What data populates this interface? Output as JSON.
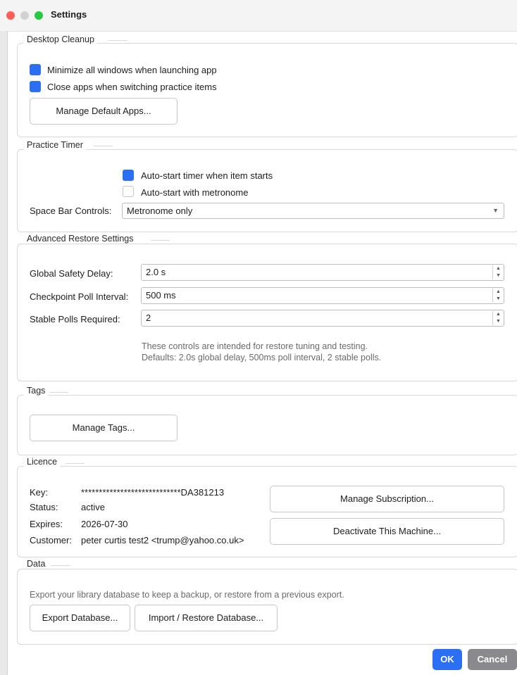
{
  "window": {
    "title": "Settings"
  },
  "desktop_cleanup": {
    "legend": "Desktop Cleanup",
    "minimize_label": "Minimize all windows when launching app",
    "minimize_checked": true,
    "close_apps_label": "Close apps when switching practice items",
    "close_apps_checked": true,
    "manage_apps_button": "Manage Default Apps..."
  },
  "practice_timer": {
    "legend": "Practice Timer",
    "autostart_label": "Auto-start timer when item starts",
    "autostart_checked": true,
    "metronome_label": "Auto-start with metronome",
    "metronome_checked": false,
    "space_bar_label": "Space Bar Controls:",
    "space_bar_value": "Metronome only"
  },
  "advanced_restore": {
    "legend": "Advanced Restore Settings",
    "global_delay_label": "Global Safety Delay:",
    "global_delay_value": "2.0 s",
    "poll_interval_label": "Checkpoint Poll Interval:",
    "poll_interval_value": "500 ms",
    "stable_polls_label": "Stable Polls Required:",
    "stable_polls_value": "2",
    "note_line1": "These controls are intended for restore tuning and testing.",
    "note_line2": "Defaults: 2.0s global delay, 500ms poll interval, 2 stable polls."
  },
  "tags": {
    "legend": "Tags",
    "manage_tags_button": "Manage Tags..."
  },
  "licence": {
    "legend": "Licence",
    "key_label": "Key:",
    "key_value": "****************************DA381213",
    "status_label": "Status:",
    "status_value": "active",
    "expires_label": "Expires:",
    "expires_value": "2026-07-30",
    "customer_label": "Customer:",
    "customer_value": "peter curtis test2 <trump@yahoo.co.uk>",
    "manage_subscription_button": "Manage Subscription...",
    "deactivate_button": "Deactivate This Machine..."
  },
  "data_section": {
    "legend": "Data",
    "description": "Export your library database to keep a backup, or restore from a previous export.",
    "export_button": "Export Database...",
    "import_button": "Import / Restore Database..."
  },
  "footer": {
    "ok_button": "OK",
    "cancel_button": "Cancel"
  },
  "colors": {
    "accent": "#2b6ff5",
    "cancel": "#8a8a8e",
    "traffic_red": "#ff5f57",
    "traffic_green": "#28c840"
  }
}
